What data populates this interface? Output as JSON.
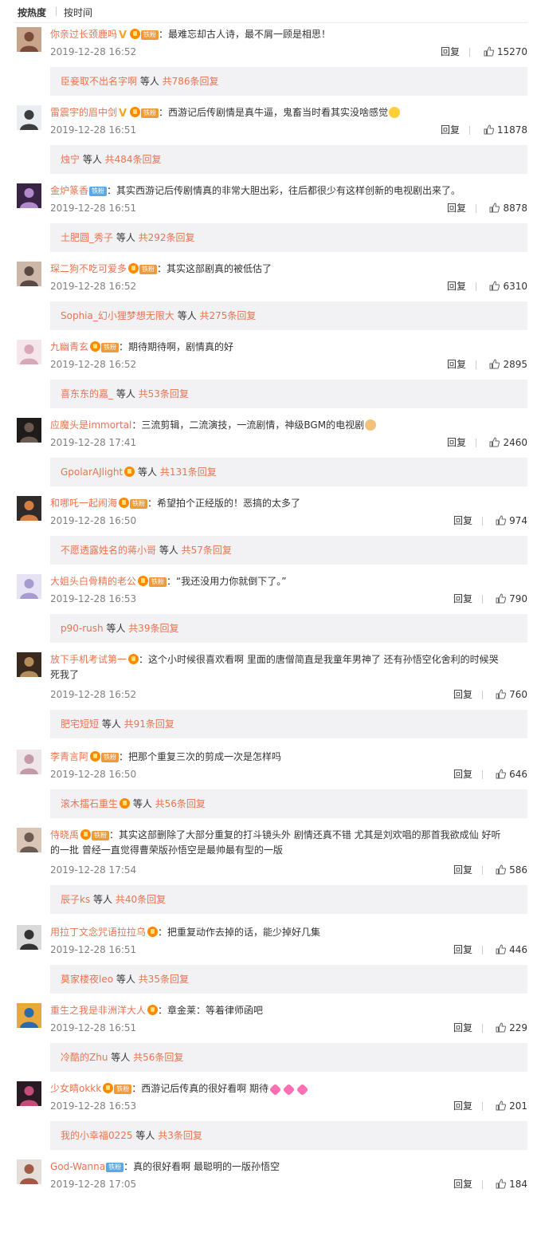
{
  "tabs": {
    "hot": "按热度",
    "time": "按时间"
  },
  "reply_label": "回复",
  "sub_mid": " 等人 ",
  "comments": [
    {
      "user": "你亲过长颈鹿吗",
      "v": true,
      "lv": true,
      "fan": "铁粉",
      "fan_color": "orange",
      "text": "：最难忘却古人诗，最不屑一顾是相思！",
      "time": "2019-12-28 16:52",
      "likes": "15270",
      "sub_user": "臣妾取不出名字啊",
      "sub_count": "共786条回复"
    },
    {
      "user": "雷震宇的眉中剑",
      "v": true,
      "lv": true,
      "fan": "铁粉",
      "fan_color": "orange",
      "text": "：西游记后传剧情是真牛逼，鬼畜当时看其实没啥感觉",
      "emoji": "laugh",
      "time": "2019-12-28 16:51",
      "likes": "11878",
      "sub_user": "烛宁",
      "sub_count": "共484条回复"
    },
    {
      "user": "金炉篆香",
      "v": false,
      "lv": false,
      "fan": "铁粉",
      "fan_color": "blue",
      "text": "：其实西游记后传剧情真的非常大胆出彩，往后都很少有这样创新的电视剧出来了。",
      "time": "2019-12-28 16:51",
      "likes": "8878",
      "sub_user": "土肥圆_秀子",
      "sub_count": "共292条回复"
    },
    {
      "user": "琛二狗不吃可爱多",
      "v": false,
      "lv": true,
      "fan": "铁粉",
      "fan_color": "orange",
      "text": "：其实这部剧真的被低估了",
      "time": "2019-12-28 16:52",
      "likes": "6310",
      "sub_user": "Sophia_幻小狸梦想无限大",
      "sub_count": "共275条回复"
    },
    {
      "user": "九幽青玄",
      "v": false,
      "lv": true,
      "fan": "铁粉",
      "fan_color": "orange",
      "text": "：期待期待啊，剧情真的好",
      "time": "2019-12-28 16:52",
      "likes": "2895",
      "sub_user": "喜东东的嘉_",
      "sub_count": "共53条回复"
    },
    {
      "user": "应魔头是immortal",
      "v": false,
      "lv": false,
      "fan": "",
      "text": "：三流剪辑，二流演技，一流剧情，神级BGM的电视剧",
      "emoji": "doge",
      "time": "2019-12-28 17:41",
      "likes": "2460",
      "sub_user": "GpolarAJlight",
      "sub_lv": true,
      "sub_count": "共131条回复"
    },
    {
      "user": "和哪吒一起闹海",
      "v": false,
      "lv": true,
      "fan": "铁粉",
      "fan_color": "orange",
      "text": "：希望拍个正经版的！恶搞的太多了",
      "time": "2019-12-28 16:50",
      "likes": "974",
      "sub_user": "不愿透露姓名的蒋小哥",
      "sub_count": "共57条回复"
    },
    {
      "user": "大姐头白骨精的老公",
      "v": false,
      "lv": true,
      "fan": "铁粉",
      "fan_color": "orange",
      "text": "：“我还没用力你就倒下了。”",
      "time": "2019-12-28 16:53",
      "likes": "790",
      "sub_user": "p90-rush",
      "sub_count": "共39条回复"
    },
    {
      "user": "放下手机考试第一",
      "v": false,
      "lv": true,
      "fan": "",
      "text": "：这个小时候很喜欢看啊 里面的唐僧简直是我童年男神了 还有孙悟空化舍利的时候哭",
      "text2": "死我了",
      "time": "2019-12-28 16:52",
      "likes": "760",
      "sub_user": "肥宅短短",
      "sub_count": "共91条回复"
    },
    {
      "user": "李青言阿",
      "v": false,
      "lv": true,
      "fan": "铁粉",
      "fan_color": "orange",
      "text": "：把那个重复三次的剪成一次是怎样吗",
      "time": "2019-12-28 16:50",
      "likes": "646",
      "sub_user": "滚木擂石重生",
      "sub_lv": true,
      "sub_count": "共56条回复"
    },
    {
      "user": "侍晓禹",
      "v": false,
      "lv": true,
      "fan": "铁粉",
      "fan_color": "orange",
      "text": "：其实这部删除了大部分重复的打斗镜头外 剧情还真不错 尤其是刘欢唱的那首我欲成仙 好听",
      "text2": "的一批 曾经一直觉得曹荣版孙悟空是最帅最有型的一版",
      "time": "2019-12-28 17:54",
      "likes": "586",
      "sub_user": "辰子ks",
      "sub_count": "共40条回复"
    },
    {
      "user": "用拉丁文念咒语拉拉乌",
      "v": false,
      "lv": true,
      "fan": "",
      "text": "：把重复动作去掉的话，能少掉好几集",
      "time": "2019-12-28 16:51",
      "likes": "446",
      "sub_user": "莫家楼夜leo",
      "sub_count": "共35条回复"
    },
    {
      "user": "重生之我是非洲洋大人",
      "v": false,
      "lv": true,
      "fan": "",
      "text": "：章金莱：等着律师函吧",
      "time": "2019-12-28 16:51",
      "likes": "229",
      "sub_user": "冷酷的Zhu",
      "sub_count": "共56条回复"
    },
    {
      "user": "少女晴okkk",
      "v": false,
      "lv": true,
      "fan": "铁粉",
      "fan_color": "orange",
      "text": "：西游记后传真的很好看啊 期待",
      "emoji": "hearts",
      "time": "2019-12-28 16:53",
      "likes": "201",
      "sub_user": "我的小幸福0225",
      "sub_count": "共3条回复"
    },
    {
      "user": "God-Wanna",
      "v": false,
      "lv": false,
      "fan": "铁粉",
      "fan_color": "blue",
      "text": "：真的很好看啊 最聪明的一版孙悟空",
      "time": "2019-12-28 17:05",
      "likes": "184",
      "sub_user": "",
      "sub_count": ""
    }
  ],
  "colors": {
    "link": "#eb7350",
    "meta": "#808080",
    "subbox_bg": "#f2f2f5"
  }
}
